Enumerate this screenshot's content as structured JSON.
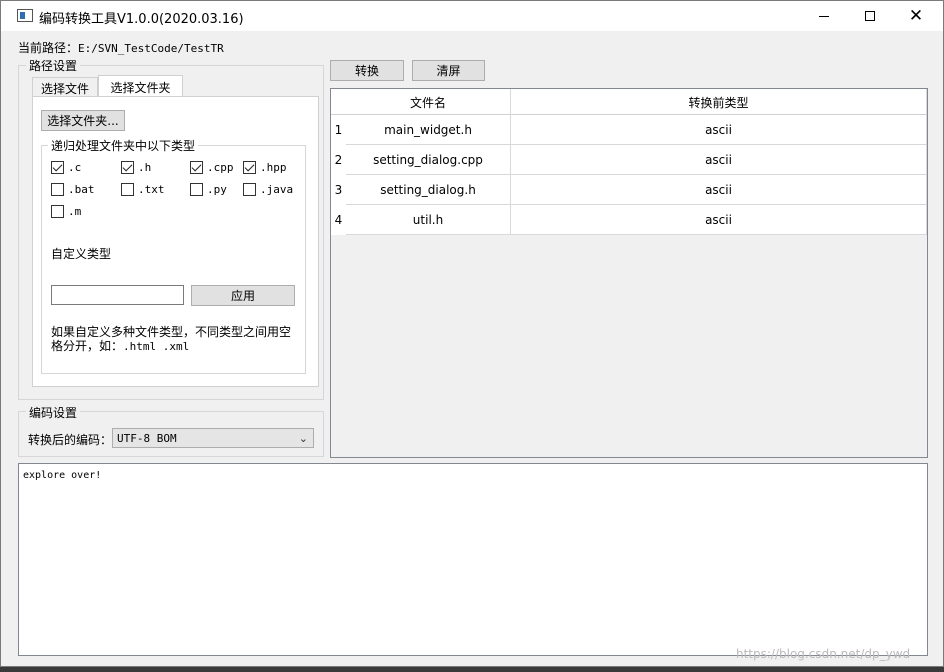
{
  "window": {
    "title": "编码转换工具V1.0.0(2020.03.16)",
    "controls": {
      "minimize": "—",
      "maximize": "☐",
      "close": "✕"
    }
  },
  "path": {
    "label": "当前路径：",
    "value": "E:/SVN_TestCode/TestTR"
  },
  "path_settings": {
    "title": "路径设置",
    "tabs": [
      "选择文件",
      "选择文件夹"
    ],
    "active_tab": "选择文件夹",
    "select_folder_button": "选择文件夹...",
    "recursive_group_title": "递归处理文件夹中以下类型",
    "file_types": [
      {
        "label": ".c",
        "checked": true
      },
      {
        "label": ".h",
        "checked": true
      },
      {
        "label": ".cpp",
        "checked": true
      },
      {
        "label": ".hpp",
        "checked": true
      },
      {
        "label": ".bat",
        "checked": false
      },
      {
        "label": ".txt",
        "checked": false
      },
      {
        "label": ".py",
        "checked": false
      },
      {
        "label": ".java",
        "checked": false
      },
      {
        "label": ".m",
        "checked": false
      }
    ],
    "custom_type_label": "自定义类型",
    "custom_type_value": "",
    "apply_button": "应用",
    "hint_line1": "如果自定义多种文件类型，不同类型之间用空",
    "hint_line2_prefix": "格分开，如：",
    "hint_line2_example": ".html .xml"
  },
  "encoding_settings": {
    "title": "编码设置",
    "label": "转换后的编码：",
    "selected": "UTF-8 BOM"
  },
  "toolbar": {
    "convert_button": "转换",
    "clear_button": "清屏"
  },
  "table": {
    "headers": [
      "文件名",
      "转换前类型"
    ],
    "rows": [
      {
        "num": "1",
        "filename": "main_widget.h",
        "type": "ascii"
      },
      {
        "num": "2",
        "filename": "setting_dialog.cpp",
        "type": "ascii"
      },
      {
        "num": "3",
        "filename": "setting_dialog.h",
        "type": "ascii"
      },
      {
        "num": "4",
        "filename": "util.h",
        "type": "ascii"
      }
    ]
  },
  "log": {
    "text": "explore over!"
  },
  "watermark": "https://blog.csdn.net/dp_ywd"
}
